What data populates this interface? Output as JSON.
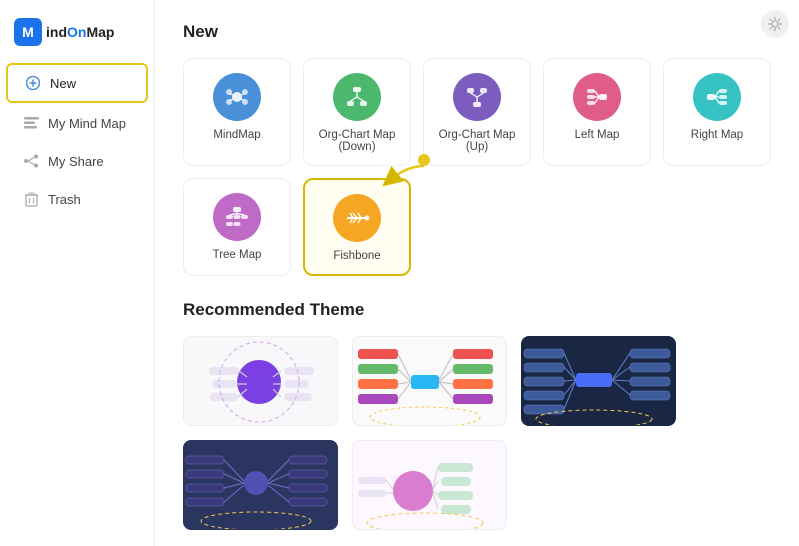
{
  "logo": {
    "text_m": "M",
    "text_full": "MindOnMap"
  },
  "sidebar": {
    "items": [
      {
        "id": "new",
        "label": "New",
        "icon": "➕",
        "active": true
      },
      {
        "id": "mymindmap",
        "label": "My Mind Map",
        "icon": "🗂",
        "active": false
      },
      {
        "id": "myshare",
        "label": "My Share",
        "icon": "⬡",
        "active": false
      },
      {
        "id": "trash",
        "label": "Trash",
        "icon": "🗑",
        "active": false
      }
    ]
  },
  "main": {
    "new_section": {
      "title": "New",
      "maps": [
        {
          "id": "mindmap",
          "label": "MindMap",
          "color": "#4a90d9",
          "icon": "✦"
        },
        {
          "id": "orgchartdown",
          "label": "Org-Chart Map (Down)",
          "color": "#4cb86e",
          "icon": "⊞"
        },
        {
          "id": "orgchartup",
          "label": "Org-Chart Map (Up)",
          "color": "#7c5cbf",
          "icon": "⎔"
        },
        {
          "id": "leftmap",
          "label": "Left Map",
          "color": "#e05c8a",
          "icon": "⊟"
        },
        {
          "id": "rightmap",
          "label": "Right Map",
          "color": "#36c2c2",
          "icon": "⊞"
        },
        {
          "id": "treemap",
          "label": "Tree Map",
          "color": "#c06ac8",
          "icon": "⊕"
        },
        {
          "id": "fishbone",
          "label": "Fishbone",
          "color": "#f5a623",
          "icon": "✿",
          "selected": true
        }
      ]
    },
    "recommended_section": {
      "title": "Recommended Theme",
      "themes": [
        {
          "id": "theme1",
          "type": "light-purple",
          "bg": "#ffffff"
        },
        {
          "id": "theme2",
          "type": "light-colorful",
          "bg": "#ffffff"
        },
        {
          "id": "theme3",
          "type": "dark-blue",
          "bg": "#1a2744"
        },
        {
          "id": "theme4",
          "type": "dark-purple",
          "bg": "#2a3560"
        },
        {
          "id": "theme5",
          "type": "light-pink",
          "bg": "#ffffff"
        }
      ]
    }
  },
  "settings_icon": "⚙"
}
